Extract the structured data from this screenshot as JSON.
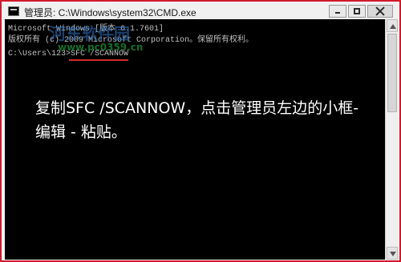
{
  "window": {
    "title": "管理员: C:\\Windows\\system32\\CMD.exe",
    "controls": {
      "minimize_icon": "minimize-icon",
      "maximize_icon": "maximize-icon",
      "close_icon": "close-icon"
    }
  },
  "console": {
    "lines": [
      "Microsoft Windows [版本 6.1.7601]",
      "版权所有 (c) 2009 Microsoft Corporation。保留所有权利。"
    ],
    "prompt": "C:\\Users\\123>",
    "command": "SFC /SCANNOW"
  },
  "watermark": {
    "line1": "河东软件园",
    "line2": "www.pc0359.cn"
  },
  "instruction": "复制SFC /SCANNOW，点击管理员左边的小框-编辑 - 粘贴。",
  "colors": {
    "console_bg": "#000000",
    "console_text": "#c0c0c0",
    "overlay_text": "#ffffff",
    "underline": "#d02a2a",
    "frame_red": "#d11a2a"
  }
}
